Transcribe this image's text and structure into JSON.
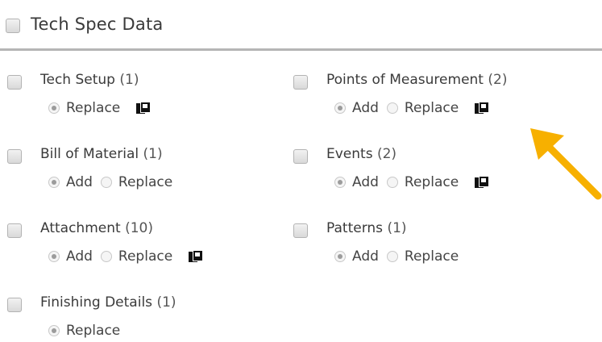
{
  "header": {
    "title": "Tech Spec Data"
  },
  "columns": [
    [
      {
        "label": "Tech Setup",
        "count": "(1)",
        "options": [
          "Replace"
        ],
        "selected": "Replace",
        "copy": true
      },
      {
        "label": "Bill of Material",
        "count": "(1)",
        "options": [
          "Add",
          "Replace"
        ],
        "selected": "Add",
        "copy": false
      },
      {
        "label": "Attachment",
        "count": "(10)",
        "options": [
          "Add",
          "Replace"
        ],
        "selected": "Add",
        "copy": true
      },
      {
        "label": "Finishing Details",
        "count": "(1)",
        "options": [
          "Replace"
        ],
        "selected": "Replace",
        "copy": false
      }
    ],
    [
      {
        "label": "Points of Measurement",
        "count": "(2)",
        "options": [
          "Add",
          "Replace"
        ],
        "selected": "Add",
        "copy": true
      },
      {
        "label": "Events",
        "count": "(2)",
        "options": [
          "Add",
          "Replace"
        ],
        "selected": "Add",
        "copy": true
      },
      {
        "label": "Patterns",
        "count": "(1)",
        "options": [
          "Add",
          "Replace"
        ],
        "selected": "Add",
        "copy": false
      }
    ]
  ],
  "colors": {
    "arrow": "#f7b000"
  },
  "icons": {
    "copy": "copy-icon",
    "annotation": "arrow-annotation-icon"
  }
}
